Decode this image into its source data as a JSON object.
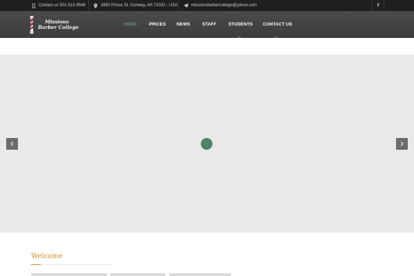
{
  "topbar": {
    "phone": "Contact us 501-513-9546",
    "address": "2850 Prince St. Conway, AR 72032 - USA",
    "email": "missionsbarbercollege@yahoo.com",
    "social_icon": "facebook-icon"
  },
  "header": {
    "logo_line1": "Missions",
    "logo_line2": "Barber College",
    "nav": [
      {
        "label": "HOME",
        "active": true
      },
      {
        "label": "PRICES",
        "active": false
      },
      {
        "label": "NEWS",
        "active": false
      },
      {
        "label": "STAFF",
        "active": false
      },
      {
        "label": "STUDENTS",
        "active": false
      },
      {
        "label": "CONTACT US",
        "active": false
      }
    ]
  },
  "slider": {
    "prev_icon": "chevron-left-icon",
    "next_icon": "chevron-right-icon",
    "loader_color": "#4f8368"
  },
  "content": {
    "welcome_heading": "Welcome"
  },
  "colors": {
    "accent": "#6fb38b",
    "heading": "#d28c29",
    "topbar_bg": "#1f1f1f",
    "header_bg": "#444444"
  }
}
